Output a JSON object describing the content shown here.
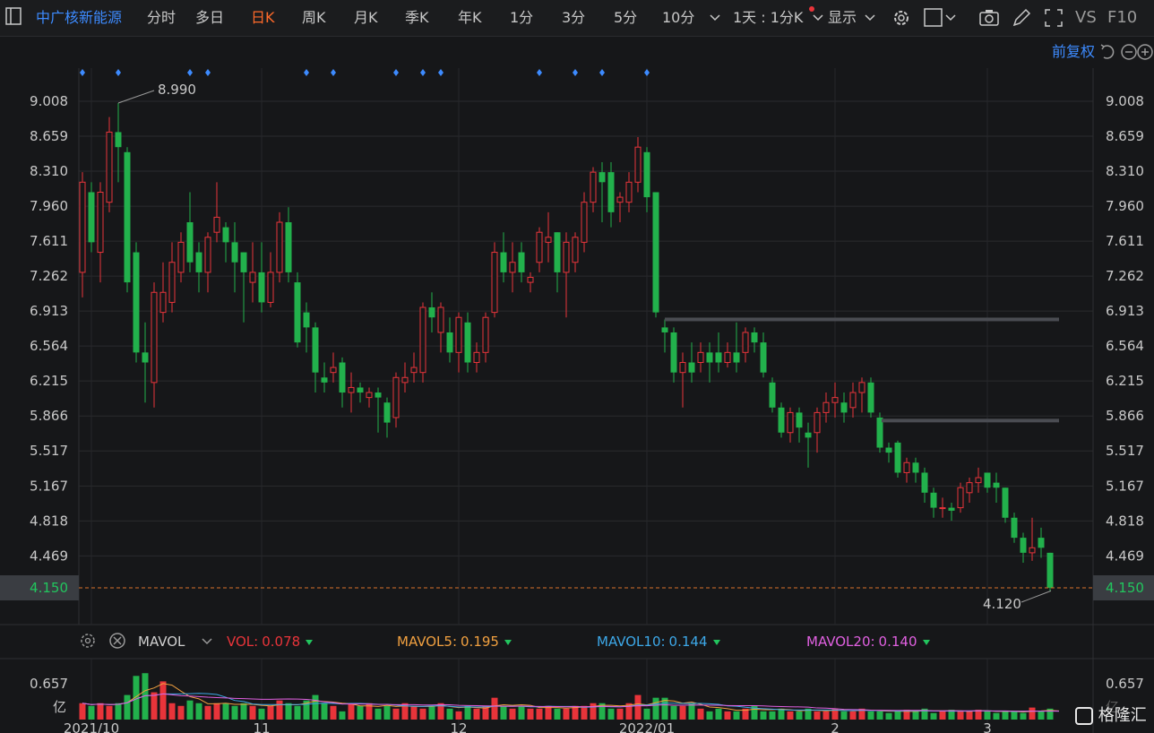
{
  "toolbar": {
    "stock_name": "中广核新能源",
    "periods": [
      "分时",
      "多日",
      "日K",
      "周K",
      "月K",
      "季K",
      "年K",
      "1分",
      "3分",
      "5分",
      "10分"
    ],
    "active_period": "日K",
    "interval_select": "1天 : 1分K",
    "display_label": "显示",
    "compare_label": "VS",
    "f10_label": "F10"
  },
  "adjust_label": "前复权",
  "price_axis_labels": [
    "9.008",
    "8.659",
    "8.310",
    "7.960",
    "7.611",
    "7.262",
    "6.913",
    "6.564",
    "6.215",
    "5.866",
    "5.517",
    "5.167",
    "4.818",
    "4.469"
  ],
  "current_price_label": "4.150",
  "high_annotation": "8.990",
  "low_annotation": "4.120",
  "date_labels": [
    "2021/10",
    "11",
    "12",
    "2022/01",
    "2",
    "3"
  ],
  "volume_panel": {
    "indicator": "MAVOL",
    "vol_label": "VOL:",
    "vol_value": "0.078",
    "mavol5_label": "MAVOL5:",
    "mavol5_value": "0.195",
    "mavol10_label": "MAVOL10:",
    "mavol10_value": "0.144",
    "mavol20_label": "MAVOL20:",
    "mavol20_value": "0.140",
    "axis_value": "0.657",
    "axis_unit": "亿"
  },
  "watermark": "格隆汇",
  "colors": {
    "up": "#e8343a",
    "down": "#22b14c",
    "active": "#ff6a2a",
    "link": "#3d8bff",
    "mavol5": "#f0a040",
    "mavol10": "#3da8e8",
    "mavol20": "#e060e0"
  },
  "chart_data": {
    "type": "candlestick",
    "ylim": [
      4.15,
      9.008
    ],
    "current_price": 4.15,
    "max_price": 8.99,
    "min_price": 4.12,
    "resistance_levels": [
      6.83,
      5.82
    ],
    "candles": [
      {
        "o": 7.3,
        "c": 8.2,
        "h": 8.3,
        "l": 7.05
      },
      {
        "o": 8.1,
        "c": 7.6,
        "h": 8.2,
        "l": 7.5
      },
      {
        "o": 7.5,
        "c": 8.1,
        "h": 8.2,
        "l": 7.2
      },
      {
        "o": 8.0,
        "c": 8.7,
        "h": 8.85,
        "l": 7.9
      },
      {
        "o": 8.7,
        "c": 8.55,
        "h": 8.99,
        "l": 8.2
      },
      {
        "o": 8.5,
        "c": 7.2,
        "h": 8.55,
        "l": 7.1
      },
      {
        "o": 7.5,
        "c": 6.5,
        "h": 7.6,
        "l": 6.4
      },
      {
        "o": 6.5,
        "c": 6.4,
        "h": 6.8,
        "l": 6.0
      },
      {
        "o": 6.2,
        "c": 7.1,
        "h": 7.2,
        "l": 5.95
      },
      {
        "o": 6.9,
        "c": 7.1,
        "h": 7.4,
        "l": 6.8
      },
      {
        "o": 7.0,
        "c": 7.4,
        "h": 7.6,
        "l": 6.9
      },
      {
        "o": 7.3,
        "c": 7.6,
        "h": 7.7,
        "l": 7.2
      },
      {
        "o": 7.8,
        "c": 7.4,
        "h": 8.1,
        "l": 7.3
      },
      {
        "o": 7.5,
        "c": 7.3,
        "h": 7.6,
        "l": 7.1
      },
      {
        "o": 7.3,
        "c": 7.65,
        "h": 7.7,
        "l": 7.1
      },
      {
        "o": 7.7,
        "c": 7.85,
        "h": 8.2,
        "l": 7.6
      },
      {
        "o": 7.75,
        "c": 7.6,
        "h": 7.8,
        "l": 7.4
      },
      {
        "o": 7.6,
        "c": 7.4,
        "h": 7.8,
        "l": 7.1
      },
      {
        "o": 7.5,
        "c": 7.3,
        "h": 7.5,
        "l": 6.8
      },
      {
        "o": 7.2,
        "c": 7.3,
        "h": 7.6,
        "l": 7.0
      },
      {
        "o": 7.3,
        "c": 7.0,
        "h": 7.6,
        "l": 6.9
      },
      {
        "o": 7.0,
        "c": 7.3,
        "h": 7.5,
        "l": 6.95
      },
      {
        "o": 7.3,
        "c": 7.8,
        "h": 7.9,
        "l": 7.2
      },
      {
        "o": 7.8,
        "c": 7.3,
        "h": 7.95,
        "l": 7.2
      },
      {
        "o": 7.2,
        "c": 6.6,
        "h": 7.3,
        "l": 6.55
      },
      {
        "o": 6.9,
        "c": 6.75,
        "h": 7.0,
        "l": 6.5
      },
      {
        "o": 6.75,
        "c": 6.3,
        "h": 6.8,
        "l": 6.1
      },
      {
        "o": 6.25,
        "c": 6.2,
        "h": 6.4,
        "l": 6.1
      },
      {
        "o": 6.3,
        "c": 6.35,
        "h": 6.5,
        "l": 6.2
      },
      {
        "o": 6.4,
        "c": 6.1,
        "h": 6.45,
        "l": 5.95
      },
      {
        "o": 6.1,
        "c": 6.15,
        "h": 6.3,
        "l": 5.9
      },
      {
        "o": 6.15,
        "c": 6.1,
        "h": 6.2,
        "l": 6.0
      },
      {
        "o": 6.05,
        "c": 6.1,
        "h": 6.15,
        "l": 5.95
      },
      {
        "o": 6.1,
        "c": 6.05,
        "h": 6.15,
        "l": 5.7
      },
      {
        "o": 6.0,
        "c": 5.8,
        "h": 6.05,
        "l": 5.65
      },
      {
        "o": 5.85,
        "c": 6.25,
        "h": 6.3,
        "l": 5.75
      },
      {
        "o": 6.2,
        "c": 6.25,
        "h": 6.4,
        "l": 6.1
      },
      {
        "o": 6.3,
        "c": 6.35,
        "h": 6.5,
        "l": 6.2
      },
      {
        "o": 6.3,
        "c": 6.95,
        "h": 7.0,
        "l": 6.2
      },
      {
        "o": 6.95,
        "c": 6.85,
        "h": 7.1,
        "l": 6.7
      },
      {
        "o": 6.7,
        "c": 6.95,
        "h": 7.0,
        "l": 6.5
      },
      {
        "o": 6.7,
        "c": 6.5,
        "h": 6.85,
        "l": 6.4
      },
      {
        "o": 6.5,
        "c": 6.85,
        "h": 6.9,
        "l": 6.3
      },
      {
        "o": 6.8,
        "c": 6.4,
        "h": 6.9,
        "l": 6.3
      },
      {
        "o": 6.4,
        "c": 6.5,
        "h": 6.6,
        "l": 6.3
      },
      {
        "o": 6.5,
        "c": 6.85,
        "h": 6.9,
        "l": 6.4
      },
      {
        "o": 6.9,
        "c": 7.5,
        "h": 7.6,
        "l": 6.85
      },
      {
        "o": 7.5,
        "c": 7.3,
        "h": 7.7,
        "l": 7.2
      },
      {
        "o": 7.3,
        "c": 7.4,
        "h": 7.6,
        "l": 7.1
      },
      {
        "o": 7.5,
        "c": 7.3,
        "h": 7.6,
        "l": 7.2
      },
      {
        "o": 7.2,
        "c": 7.25,
        "h": 7.3,
        "l": 7.1
      },
      {
        "o": 7.4,
        "c": 7.7,
        "h": 7.75,
        "l": 7.3
      },
      {
        "o": 7.6,
        "c": 7.65,
        "h": 7.9,
        "l": 7.4
      },
      {
        "o": 7.7,
        "c": 7.3,
        "h": 7.7,
        "l": 7.1
      },
      {
        "o": 7.3,
        "c": 7.6,
        "h": 7.7,
        "l": 6.85
      },
      {
        "o": 7.4,
        "c": 7.65,
        "h": 7.7,
        "l": 7.3
      },
      {
        "o": 7.6,
        "c": 8.0,
        "h": 8.1,
        "l": 7.5
      },
      {
        "o": 8.0,
        "c": 8.3,
        "h": 8.35,
        "l": 7.9
      },
      {
        "o": 8.3,
        "c": 8.2,
        "h": 8.4,
        "l": 7.8
      },
      {
        "o": 8.3,
        "c": 7.9,
        "h": 8.4,
        "l": 7.75
      },
      {
        "o": 8.0,
        "c": 8.05,
        "h": 8.1,
        "l": 7.8
      },
      {
        "o": 8.0,
        "c": 8.2,
        "h": 8.3,
        "l": 7.9
      },
      {
        "o": 8.2,
        "c": 8.55,
        "h": 8.65,
        "l": 8.1
      },
      {
        "o": 8.5,
        "c": 8.05,
        "h": 8.55,
        "l": 7.9
      },
      {
        "o": 8.1,
        "c": 6.9,
        "h": 8.1,
        "l": 6.85
      },
      {
        "o": 6.75,
        "c": 6.7,
        "h": 6.83,
        "l": 6.5
      },
      {
        "o": 6.7,
        "c": 6.3,
        "h": 6.75,
        "l": 6.2
      },
      {
        "o": 6.3,
        "c": 6.4,
        "h": 6.5,
        "l": 5.95
      },
      {
        "o": 6.4,
        "c": 6.3,
        "h": 6.6,
        "l": 6.2
      },
      {
        "o": 6.4,
        "c": 6.5,
        "h": 6.6,
        "l": 6.3
      },
      {
        "o": 6.5,
        "c": 6.4,
        "h": 6.6,
        "l": 6.2
      },
      {
        "o": 6.5,
        "c": 6.4,
        "h": 6.7,
        "l": 6.3
      },
      {
        "o": 6.4,
        "c": 6.5,
        "h": 6.6,
        "l": 6.35
      },
      {
        "o": 6.5,
        "c": 6.4,
        "h": 6.8,
        "l": 6.3
      },
      {
        "o": 6.5,
        "c": 6.7,
        "h": 6.75,
        "l": 6.4
      },
      {
        "o": 6.7,
        "c": 6.6,
        "h": 6.75,
        "l": 6.5
      },
      {
        "o": 6.6,
        "c": 6.3,
        "h": 6.7,
        "l": 6.25
      },
      {
        "o": 6.2,
        "c": 5.95,
        "h": 6.25,
        "l": 5.9
      },
      {
        "o": 5.95,
        "c": 5.7,
        "h": 6.0,
        "l": 5.65
      },
      {
        "o": 5.7,
        "c": 5.9,
        "h": 5.95,
        "l": 5.6
      },
      {
        "o": 5.9,
        "c": 5.75,
        "h": 5.95,
        "l": 5.6
      },
      {
        "o": 5.7,
        "c": 5.65,
        "h": 5.8,
        "l": 5.35
      },
      {
        "o": 5.7,
        "c": 5.9,
        "h": 5.95,
        "l": 5.5
      },
      {
        "o": 5.9,
        "c": 6.0,
        "h": 6.1,
        "l": 5.8
      },
      {
        "o": 6.0,
        "c": 6.05,
        "h": 6.2,
        "l": 5.85
      },
      {
        "o": 6.0,
        "c": 5.9,
        "h": 6.1,
        "l": 5.8
      },
      {
        "o": 5.95,
        "c": 6.1,
        "h": 6.2,
        "l": 5.85
      },
      {
        "o": 6.1,
        "c": 6.2,
        "h": 6.25,
        "l": 5.9
      },
      {
        "o": 6.2,
        "c": 5.9,
        "h": 6.25,
        "l": 5.85
      },
      {
        "o": 5.85,
        "c": 5.55,
        "h": 5.9,
        "l": 5.5
      },
      {
        "o": 5.55,
        "c": 5.5,
        "h": 5.6,
        "l": 5.4
      },
      {
        "o": 5.6,
        "c": 5.3,
        "h": 5.62,
        "l": 5.25
      },
      {
        "o": 5.3,
        "c": 5.4,
        "h": 5.45,
        "l": 5.2
      },
      {
        "o": 5.4,
        "c": 5.3,
        "h": 5.45,
        "l": 5.2
      },
      {
        "o": 5.3,
        "c": 5.1,
        "h": 5.35,
        "l": 5.0
      },
      {
        "o": 5.1,
        "c": 4.95,
        "h": 5.15,
        "l": 4.85
      },
      {
        "o": 4.95,
        "c": 4.95,
        "h": 5.05,
        "l": 4.85
      },
      {
        "o": 4.95,
        "c": 4.92,
        "h": 5.0,
        "l": 4.82
      },
      {
        "o": 4.95,
        "c": 5.15,
        "h": 5.2,
        "l": 4.9
      },
      {
        "o": 5.1,
        "c": 5.2,
        "h": 5.25,
        "l": 5.0
      },
      {
        "o": 5.2,
        "c": 5.25,
        "h": 5.35,
        "l": 5.1
      },
      {
        "o": 5.3,
        "c": 5.15,
        "h": 5.3,
        "l": 5.1
      },
      {
        "o": 5.2,
        "c": 5.15,
        "h": 5.3,
        "l": 5.0
      },
      {
        "o": 5.15,
        "c": 4.85,
        "h": 5.15,
        "l": 4.8
      },
      {
        "o": 4.85,
        "c": 4.65,
        "h": 4.9,
        "l": 4.6
      },
      {
        "o": 4.65,
        "c": 4.5,
        "h": 4.7,
        "l": 4.4
      },
      {
        "o": 4.5,
        "c": 4.55,
        "h": 4.85,
        "l": 4.42
      },
      {
        "o": 4.65,
        "c": 4.55,
        "h": 4.75,
        "l": 4.45
      },
      {
        "o": 4.5,
        "c": 4.15,
        "h": 4.5,
        "l": 4.12
      }
    ],
    "volume": [
      0.3,
      0.25,
      0.3,
      0.25,
      0.3,
      0.45,
      0.8,
      0.85,
      0.5,
      0.7,
      0.3,
      0.25,
      0.35,
      0.3,
      0.25,
      0.3,
      0.3,
      0.25,
      0.3,
      0.25,
      0.2,
      0.25,
      0.35,
      0.3,
      0.25,
      0.35,
      0.45,
      0.3,
      0.25,
      0.15,
      0.3,
      0.25,
      0.3,
      0.2,
      0.25,
      0.2,
      0.3,
      0.25,
      0.2,
      0.25,
      0.3,
      0.2,
      0.15,
      0.25,
      0.2,
      0.25,
      0.4,
      0.25,
      0.2,
      0.25,
      0.2,
      0.2,
      0.25,
      0.2,
      0.2,
      0.25,
      0.25,
      0.3,
      0.3,
      0.2,
      0.2,
      0.3,
      0.45,
      0.2,
      0.4,
      0.4,
      0.25,
      0.25,
      0.3,
      0.2,
      0.15,
      0.2,
      0.15,
      0.15,
      0.2,
      0.25,
      0.15,
      0.15,
      0.2,
      0.15,
      0.15,
      0.2,
      0.15,
      0.15,
      0.2,
      0.15,
      0.15,
      0.2,
      0.15,
      0.15,
      0.12,
      0.15,
      0.18,
      0.15,
      0.2,
      0.12,
      0.15,
      0.18,
      0.15,
      0.15,
      0.18,
      0.15,
      0.12,
      0.15,
      0.15,
      0.12,
      0.22,
      0.15,
      0.2,
      0.1
    ],
    "markers": [
      0,
      4,
      12,
      14,
      25,
      28,
      35,
      38,
      40,
      51,
      55,
      58,
      63
    ]
  }
}
